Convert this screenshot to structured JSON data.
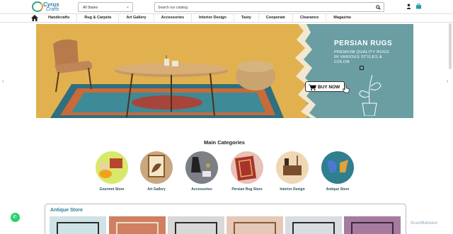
{
  "header": {
    "logo_line1": "Cyrus",
    "logo_line2": "Crafts",
    "state_select": "All States",
    "search_placeholder": "Search our catalog"
  },
  "nav": {
    "items": [
      "Handicrafts",
      "Rug & Carpets",
      "Art Gallery",
      "Accessories",
      "Interior Design",
      "Tasty",
      "Cooperate",
      "Clearance",
      "Magazine"
    ]
  },
  "banner": {
    "title": "PERSIAN RUGS",
    "subtitle": "PREMIUM QUALITY RUGS IN VARIOUS STYLES & COLOR",
    "cta": "BUY NOW"
  },
  "categories": {
    "title": "Main Categories",
    "items": [
      {
        "label": "Gourmet Store",
        "bg": "#d8e86a"
      },
      {
        "label": "Art Gallery",
        "bg": "#c9a77f"
      },
      {
        "label": "Accessories",
        "bg": "#7d7f86"
      },
      {
        "label": "Persian Rug Store",
        "bg": "#e7c2b5"
      },
      {
        "label": "Interior Design",
        "bg": "#efd7b5"
      },
      {
        "label": "Antique Store",
        "bg": "#2f7f8f"
      }
    ]
  },
  "antique": {
    "title": "Antique Store",
    "thumbs": [
      "#cfe3e6",
      "#d08060",
      "#d8d8d8",
      "#e6c8b8",
      "#d9dce0",
      "#a77aa0"
    ]
  },
  "watermark": "ScanMalware"
}
